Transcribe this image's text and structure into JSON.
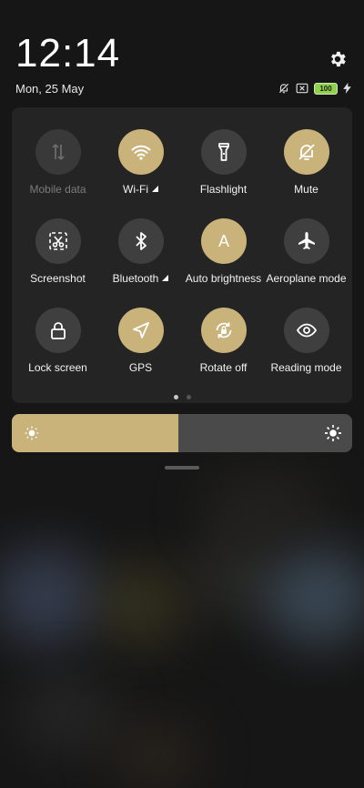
{
  "status": {
    "time": "12:14",
    "date": "Mon, 25 May",
    "battery_level": "100"
  },
  "toggles": [
    {
      "id": "mobile-data",
      "label": "Mobile data",
      "state": "disabled",
      "icon": "arrows-updown-icon"
    },
    {
      "id": "wifi",
      "label": "Wi-Fi",
      "state": "on",
      "icon": "wifi-icon",
      "signal": true
    },
    {
      "id": "flashlight",
      "label": "Flashlight",
      "state": "off",
      "icon": "flashlight-icon"
    },
    {
      "id": "mute",
      "label": "Mute",
      "state": "on",
      "icon": "bell-off-icon"
    },
    {
      "id": "screenshot",
      "label": "Screenshot",
      "state": "off",
      "icon": "scissors-icon"
    },
    {
      "id": "bluetooth",
      "label": "Bluetooth",
      "state": "off",
      "icon": "bluetooth-icon",
      "signal": true
    },
    {
      "id": "auto-brightness",
      "label": "Auto brightness",
      "state": "on",
      "icon": "letter-a-icon"
    },
    {
      "id": "aeroplane-mode",
      "label": "Aeroplane mode",
      "state": "off",
      "icon": "airplane-icon"
    },
    {
      "id": "lock-screen",
      "label": "Lock screen",
      "state": "off",
      "icon": "lock-icon"
    },
    {
      "id": "gps",
      "label": "GPS",
      "state": "on",
      "icon": "navigation-arrow-icon"
    },
    {
      "id": "rotate-off",
      "label": "Rotate off",
      "state": "on",
      "icon": "rotate-lock-icon"
    },
    {
      "id": "reading-mode",
      "label": "Reading mode",
      "state": "off",
      "icon": "eye-icon"
    }
  ],
  "pager": {
    "pages": 2,
    "current": 0
  },
  "brightness": {
    "level": 0.49
  },
  "colors": {
    "accent": "#c9b37b",
    "tile_off": "#3f3f3f",
    "panel": "#242424",
    "battery": "#8fd14f"
  }
}
